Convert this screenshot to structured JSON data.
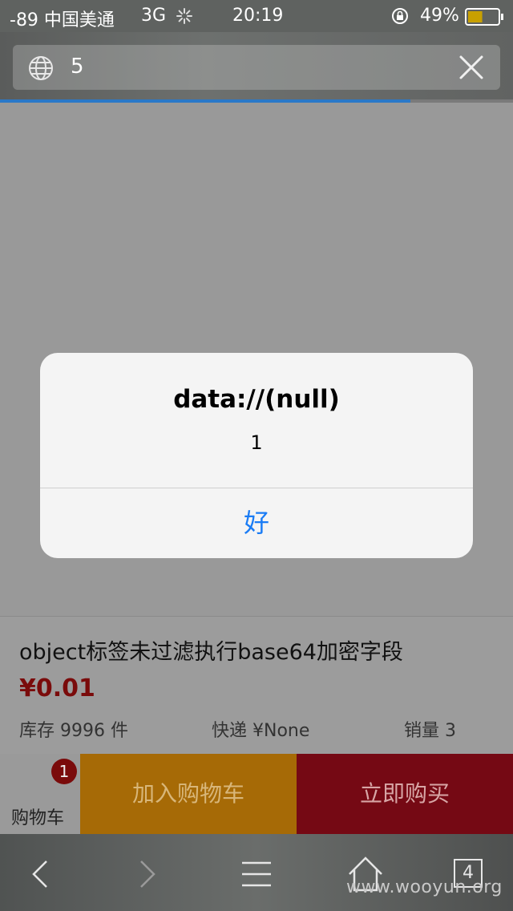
{
  "status_bar": {
    "carrier": "-89 中国美通",
    "network": "3G",
    "time": "20:19",
    "battery": "49%",
    "battery_level": 0.49
  },
  "address_bar": {
    "url_text": "5",
    "globe_icon": "globe-icon",
    "clear_icon": "close-icon"
  },
  "page_load_progress": 0.8,
  "product": {
    "title": "object标签未过滤执行base64加密字段",
    "price": "¥0.01",
    "stock": "库存 9996 件",
    "shipping": "快递 ¥None",
    "sales": "销量 3"
  },
  "bottom_bar": {
    "cart_label": "购物车",
    "cart_count": "1",
    "add_to_cart": "加入购物车",
    "buy_now": "立即购买"
  },
  "alert": {
    "title": "data://(null)",
    "message": "1",
    "ok_label": "好"
  },
  "toolbar": {
    "tab_count": "4",
    "icons": [
      "back-icon",
      "forward-icon",
      "menu-icon",
      "home-icon",
      "tabs-icon"
    ]
  },
  "watermark": "www.wooyun.org",
  "colors": {
    "accent_blue": "#1a7cf5",
    "price_red": "#7a0b0b",
    "add_cart_orange": "#a66a06",
    "buy_now_red": "#750914"
  }
}
